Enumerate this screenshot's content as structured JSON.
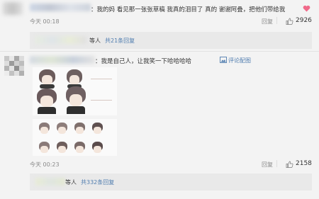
{
  "comment1": {
    "text_prefix": "：我的妈 看见那一张张草稿 我真的泪目了 真的  谢谢阿叠，把他们带给我",
    "time": "今天 00:18",
    "reply_label": "回复",
    "likes": "2926",
    "replies_prefix": "等人",
    "replies_link": "共21条回复"
  },
  "comment2": {
    "text": "：我是自己人，让我笑一下哈哈哈哈",
    "comment_with_image_label": "评论配图",
    "time": "今天 00:23",
    "reply_label": "回复",
    "likes": "2158",
    "replies_prefix": "等人",
    "replies_link": "共332条回复"
  },
  "icons": {
    "heart": "heart-icon",
    "like": "thumbs-up-icon",
    "image": "image-icon"
  },
  "colors": {
    "link": "#507daf",
    "text": "#333333",
    "meta": "#8a8a8a",
    "reply_bg": "#e9e9e9"
  }
}
